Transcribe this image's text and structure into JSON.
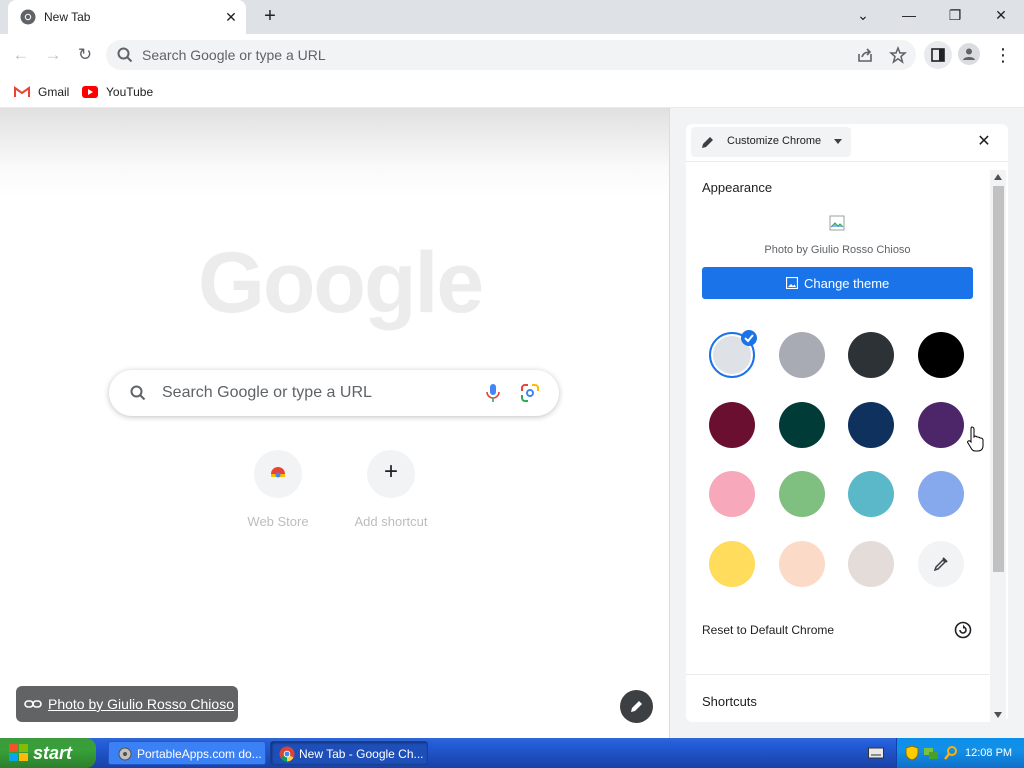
{
  "browser": {
    "tab": {
      "title": "New Tab",
      "close": "✕"
    },
    "new_tab": "+",
    "window_controls": {
      "tab_search": "⌄",
      "minimize": "—",
      "restore": "❐",
      "close": "✕"
    },
    "nav": {
      "back": "←",
      "forward": "→",
      "reload": "↻"
    },
    "omnibox": {
      "placeholder": "Search Google or type a URL"
    },
    "menu": "⋮"
  },
  "bookmarks": [
    {
      "label": "Gmail",
      "icon": "gmail-icon"
    },
    {
      "label": "YouTube",
      "icon": "youtube-icon"
    }
  ],
  "ntp": {
    "logo": "Google",
    "search_placeholder": "Search Google or type a URL",
    "shortcuts": [
      {
        "label": "Web Store",
        "icon": "chrome-web-store-icon"
      },
      {
        "label": "Add shortcut",
        "icon": "plus-icon",
        "glyph": "+"
      }
    ],
    "photo_credit": "Photo by Giulio Rosso Chioso"
  },
  "side_panel": {
    "selector_label": "Customize Chrome",
    "close": "✕",
    "appearance_title": "Appearance",
    "photo_attribution": "Photo by Giulio Rosso Chioso",
    "change_theme_label": "Change theme",
    "swatches": [
      {
        "color": "#dee1e6",
        "selected": true
      },
      {
        "color": "#a8abb3"
      },
      {
        "color": "#2c3236"
      },
      {
        "color": "#000000"
      },
      {
        "color": "#6b0f31"
      },
      {
        "color": "#003b38"
      },
      {
        "color": "#0f315e"
      },
      {
        "color": "#4d2569"
      },
      {
        "color": "#f8a8bb"
      },
      {
        "color": "#7fbf7f"
      },
      {
        "color": "#5ab8c8"
      },
      {
        "color": "#86a8ec"
      },
      {
        "color": "#ffdc5c"
      },
      {
        "color": "#fbdac8"
      },
      {
        "color": "#e4dcd8"
      },
      {
        "color": "#f1f3f4",
        "custom": true
      }
    ],
    "reset_label": "Reset to Default Chrome",
    "shortcuts_title": "Shortcuts"
  },
  "taskbar": {
    "start_label": "start",
    "tasks": [
      {
        "label": "PortableApps.com do...",
        "active": false
      },
      {
        "label": "New Tab - Google Ch...",
        "active": true
      }
    ],
    "clock": "12:08 PM"
  },
  "colors": {
    "accent": "#1a73e8",
    "titlebar": "#dee1e6",
    "panel_bg": "#f1f3f4"
  }
}
